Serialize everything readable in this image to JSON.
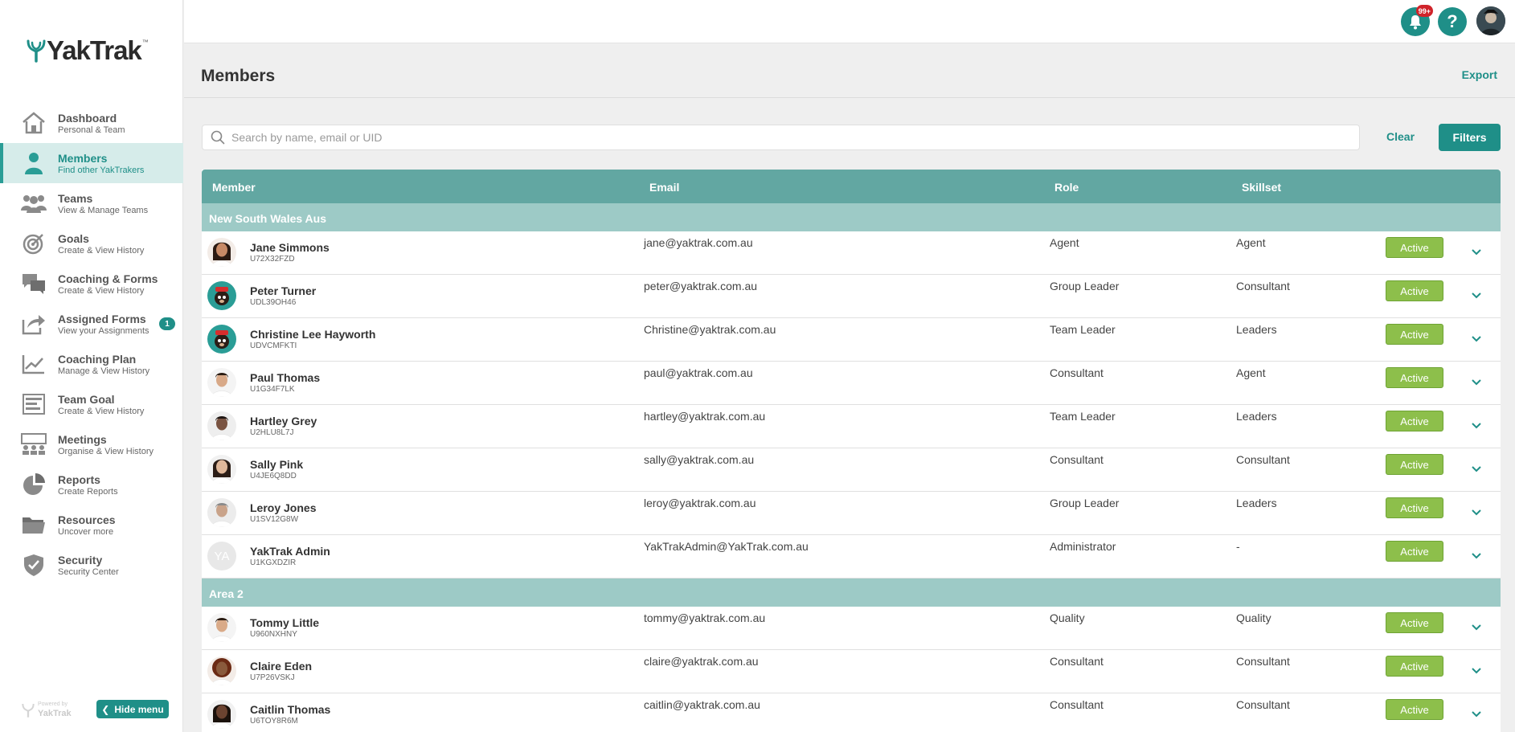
{
  "app": {
    "name": "YakTrak",
    "trademark": "™"
  },
  "sidebar": {
    "items": [
      {
        "label": "Dashboard",
        "sub": "Personal & Team",
        "icon": "house-icon",
        "active": false
      },
      {
        "label": "Members",
        "sub": "Find other YakTrakers",
        "icon": "person-icon",
        "active": true
      },
      {
        "label": "Teams",
        "sub": "View & Manage Teams",
        "icon": "team-icon",
        "active": false
      },
      {
        "label": "Goals",
        "sub": "Create & View History",
        "icon": "target-icon",
        "active": false
      },
      {
        "label": "Coaching & Forms",
        "sub": "Create & View History",
        "icon": "chat-icon",
        "active": false
      },
      {
        "label": "Assigned Forms",
        "sub": "View your Assignments",
        "icon": "share-icon",
        "active": false,
        "badge": "1"
      },
      {
        "label": "Coaching Plan",
        "sub": "Manage & View History",
        "icon": "trend-icon",
        "active": false
      },
      {
        "label": "Team Goal",
        "sub": "Create & View History",
        "icon": "list-icon",
        "active": false
      },
      {
        "label": "Meetings",
        "sub": "Organise & View History",
        "icon": "meeting-icon",
        "active": false
      },
      {
        "label": "Reports",
        "sub": "Create Reports",
        "icon": "pie-icon",
        "active": false
      },
      {
        "label": "Resources",
        "sub": "Uncover more",
        "icon": "folder-icon",
        "active": false
      },
      {
        "label": "Security",
        "sub": "Security Center",
        "icon": "shield-icon",
        "active": false
      }
    ],
    "powered_by": "Powered by",
    "powered_name": "YakTrak",
    "hide_menu": "Hide menu"
  },
  "topbar": {
    "notification_count": "99+",
    "help": "?"
  },
  "header": {
    "title": "Members",
    "export": "Export"
  },
  "search": {
    "placeholder": "Search by name, email or UID",
    "value": "",
    "clear": "Clear",
    "filters": "Filters"
  },
  "table": {
    "columns": [
      "Member",
      "Email",
      "Role",
      "Skillset"
    ],
    "groups": [
      {
        "name": "New South Wales Aus",
        "rows": [
          {
            "name": "Jane Simmons",
            "uid": "U72X32FZD",
            "email": "jane@yaktrak.com.au",
            "role": "Agent",
            "skillset": "Agent",
            "status": "Active",
            "avatar": "f1"
          },
          {
            "name": "Peter Turner",
            "uid": "UDL39OH46",
            "email": "peter@yaktrak.com.au",
            "role": "Group Leader",
            "skillset": "Consultant",
            "status": "Active",
            "avatar": "yak"
          },
          {
            "name": "Christine Lee Hayworth",
            "uid": "UDVCMFKTI",
            "email": "Christine@yaktrak.com.au",
            "role": "Team Leader",
            "skillset": "Leaders",
            "status": "Active",
            "avatar": "yak"
          },
          {
            "name": "Paul Thomas",
            "uid": "U1G34F7LK",
            "email": "paul@yaktrak.com.au",
            "role": "Consultant",
            "skillset": "Agent",
            "status": "Active",
            "avatar": "m1"
          },
          {
            "name": "Hartley Grey",
            "uid": "U2HLU8L7J",
            "email": "hartley@yaktrak.com.au",
            "role": "Team Leader",
            "skillset": "Leaders",
            "status": "Active",
            "avatar": "m2"
          },
          {
            "name": "Sally Pink",
            "uid": "U4JE6Q8DD",
            "email": "sally@yaktrak.com.au",
            "role": "Consultant",
            "skillset": "Consultant",
            "status": "Active",
            "avatar": "f2"
          },
          {
            "name": "Leroy Jones",
            "uid": "U1SV12G8W",
            "email": "leroy@yaktrak.com.au",
            "role": "Group Leader",
            "skillset": "Leaders",
            "status": "Active",
            "avatar": "m3"
          },
          {
            "name": "YakTrak Admin",
            "uid": "U1KGXDZIR",
            "email": "YakTrakAdmin@YakTrak.com.au",
            "role": "Administrator",
            "skillset": "-",
            "status": "Active",
            "avatar": "initials",
            "initials": "YA"
          }
        ]
      },
      {
        "name": "Area 2",
        "rows": [
          {
            "name": "Tommy Little",
            "uid": "U960NXHNY",
            "email": "tommy@yaktrak.com.au",
            "role": "Quality",
            "skillset": "Quality",
            "status": "Active",
            "avatar": "m4"
          },
          {
            "name": "Claire Eden",
            "uid": "U7P26VSKJ",
            "email": "claire@yaktrak.com.au",
            "role": "Consultant",
            "skillset": "Consultant",
            "status": "Active",
            "avatar": "f3"
          },
          {
            "name": "Caitlin Thomas",
            "uid": "U6TOY8R6M",
            "email": "caitlin@yaktrak.com.au",
            "role": "Consultant",
            "skillset": "Consultant",
            "status": "Active",
            "avatar": "f4"
          }
        ]
      }
    ]
  },
  "colors": {
    "accent": "#1f8f88",
    "header": "#62a7a2",
    "group": "#9dcac6",
    "active": "#8dbf4b",
    "badge": "#d0232a"
  }
}
